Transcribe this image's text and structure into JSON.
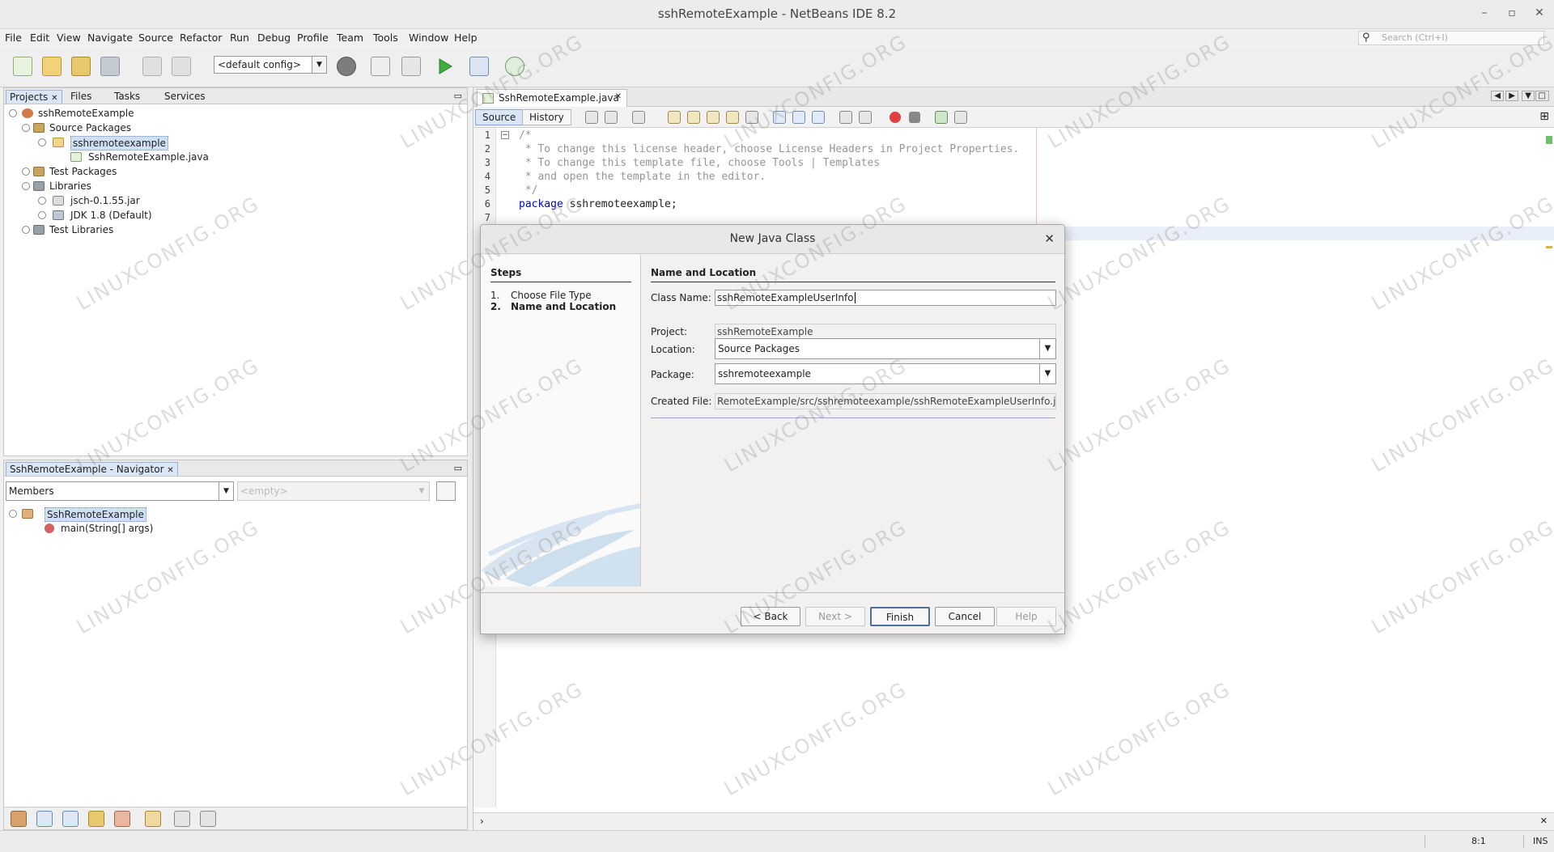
{
  "window": {
    "title": "sshRemoteExample - NetBeans IDE 8.2"
  },
  "menu": [
    "File",
    "Edit",
    "View",
    "Navigate",
    "Source",
    "Refactor",
    "Run",
    "Debug",
    "Profile",
    "Team",
    "Tools",
    "Window",
    "Help"
  ],
  "search": {
    "placeholder": "Search (Ctrl+I)"
  },
  "toolbar": {
    "config_value": "<default config>"
  },
  "projects_panel": {
    "tabs": [
      "Projects",
      "Files",
      "Tasks",
      "Services"
    ],
    "tree": {
      "project": "sshRemoteExample",
      "source_packages": "Source Packages",
      "package": "sshremoteexample",
      "file": "SshRemoteExample.java",
      "test_packages": "Test Packages",
      "libraries": "Libraries",
      "lib1": "jsch-0.1.55.jar",
      "lib2": "JDK 1.8 (Default)",
      "test_libraries": "Test Libraries"
    }
  },
  "navigator": {
    "title": "SshRemoteExample - Navigator",
    "members_select": "Members",
    "empty_select": "<empty>",
    "class_node": "SshRemoteExample",
    "method_node": "main(String[] args)"
  },
  "editor": {
    "tab_label": "SshRemoteExample.java",
    "source_btn": "Source",
    "history_btn": "History",
    "line_numbers": [
      "1",
      "2",
      "3",
      "4",
      "5",
      "6",
      "7"
    ],
    "lines": {
      "l1": "/*",
      "l2": " * To change this license header, choose License Headers in Project Properties.",
      "l3": " * To change this template file, choose Tools | Templates",
      "l4": " * and open the template in the editor.",
      "l5": " */",
      "l6_kw": "package",
      "l6_rest": " sshremoteexample;"
    }
  },
  "statusbar": {
    "position": "8:1",
    "mode": "INS"
  },
  "dialog": {
    "title": "New Java Class",
    "steps_heading": "Steps",
    "steps": [
      {
        "num": "1.",
        "label": "Choose File Type"
      },
      {
        "num": "2.",
        "label": "Name and Location"
      }
    ],
    "section_heading": "Name and Location",
    "class_name_label": "Class Name:",
    "class_name_value": "sshRemoteExampleUserInfo",
    "project_label": "Project:",
    "project_value": "sshRemoteExample",
    "location_label": "Location:",
    "location_value": "Source Packages",
    "package_label": "Package:",
    "package_value": "sshremoteexample",
    "created_file_label": "Created File:",
    "created_file_value": "RemoteExample/src/sshremoteexample/sshRemoteExampleUserInfo.java",
    "buttons": {
      "back": "< Back",
      "next": "Next >",
      "finish": "Finish",
      "cancel": "Cancel",
      "help": "Help"
    }
  },
  "watermark": "LINUXCONFIG.ORG",
  "colors": {
    "selection": "#cfe0f5",
    "keyword": "#0000e6",
    "comment": "#969696"
  }
}
